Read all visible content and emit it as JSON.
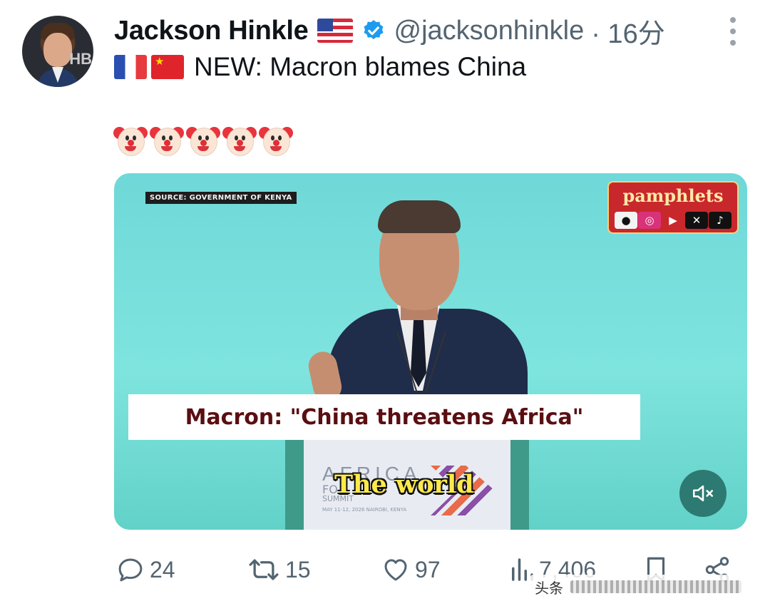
{
  "author": {
    "name": "Jackson Hinkle",
    "handle": "@jacksonhinkle",
    "time": "· 16分",
    "avatar_text": "HB"
  },
  "tweet": {
    "text": "NEW: Macron blames China",
    "emoji_count": 5
  },
  "media": {
    "source_label": "SOURCE: GOVERNMENT OF KENYA",
    "brand_name": "pamphlets",
    "caption": "Macron: \"China threatens Africa\"",
    "subtitle": "The world",
    "podium_logo_line1": "AFRICA",
    "podium_logo_line2": "FO",
    "podium_logo_line3": "SUMMIT",
    "podium_date": "MAY 11-12, 2026 NAIROBI, KENYA"
  },
  "actions": {
    "replies": "24",
    "retweets": "15",
    "likes": "97",
    "views": "7,406"
  },
  "watermark": {
    "text": "头条"
  },
  "colors": {
    "text": "#0f1419",
    "muted": "#536471",
    "verified": "#1d9bf0",
    "media_bg": "#6fd8d8"
  }
}
